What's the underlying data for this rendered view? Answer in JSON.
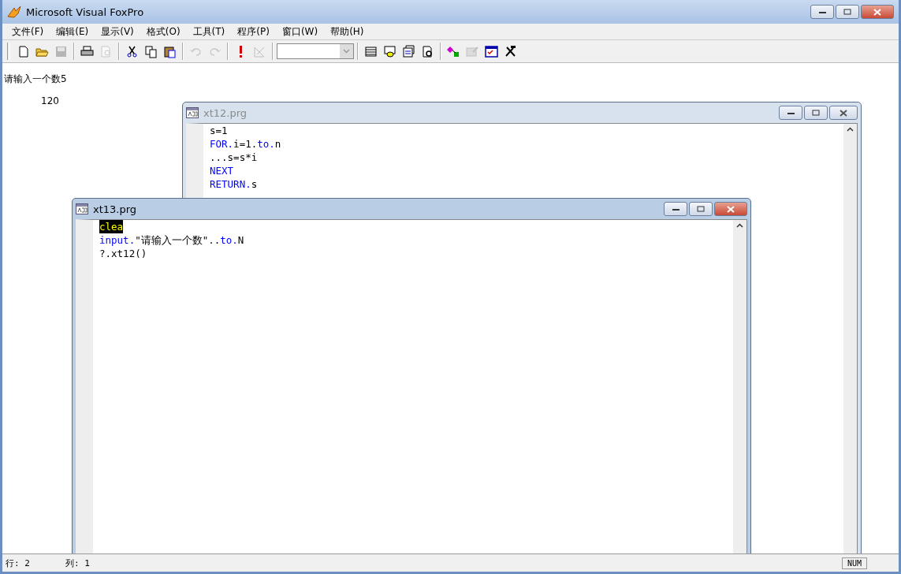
{
  "window": {
    "title": "Microsoft Visual FoxPro"
  },
  "menu": [
    "文件(F)",
    "编辑(E)",
    "显示(V)",
    "格式(O)",
    "工具(T)",
    "程序(P)",
    "窗口(W)",
    "帮助(H)"
  ],
  "toolbar": [
    {
      "kind": "button",
      "disabled": false
    },
    {
      "kind": "button",
      "disabled": false
    },
    {
      "kind": "button",
      "disabled": true
    },
    {
      "kind": "separator"
    },
    {
      "kind": "button",
      "disabled": false
    },
    {
      "kind": "button",
      "disabled": true
    },
    {
      "kind": "separator"
    },
    {
      "kind": "button",
      "disabled": false
    },
    {
      "kind": "button",
      "disabled": false
    },
    {
      "kind": "button",
      "disabled": false
    },
    {
      "kind": "separator"
    },
    {
      "kind": "button",
      "disabled": true
    },
    {
      "kind": "button",
      "disabled": true
    },
    {
      "kind": "separator"
    },
    {
      "kind": "button",
      "disabled": false
    },
    {
      "kind": "button",
      "disabled": true
    },
    {
      "kind": "separator"
    },
    {
      "kind": "combo"
    },
    {
      "kind": "separator"
    },
    {
      "kind": "button",
      "disabled": false
    },
    {
      "kind": "button",
      "disabled": false
    },
    {
      "kind": "button",
      "disabled": false
    },
    {
      "kind": "button",
      "disabled": false
    },
    {
      "kind": "separator"
    },
    {
      "kind": "button",
      "disabled": false
    },
    {
      "kind": "button",
      "disabled": true
    },
    {
      "kind": "button",
      "disabled": false
    },
    {
      "kind": "button",
      "disabled": false
    }
  ],
  "output": [
    {
      "kind": "text",
      "text": "请输入一个数5"
    },
    {
      "kind": "number",
      "text": "120"
    }
  ],
  "editors": [
    {
      "title": "xt12.prg",
      "active": false,
      "lines": [
        [
          {
            "kind": "plain",
            "text": "s=1"
          }
        ],
        [
          {
            "kind": "keyword",
            "text": "FOR."
          },
          {
            "kind": "plain",
            "text": "i=1."
          },
          {
            "kind": "keyword",
            "text": "to."
          },
          {
            "kind": "plain",
            "text": "n"
          }
        ],
        [
          {
            "kind": "plain",
            "text": "...s=s*i"
          }
        ],
        [
          {
            "kind": "keyword",
            "text": "NEXT"
          }
        ],
        [
          {
            "kind": "keyword",
            "text": "RETURN."
          },
          {
            "kind": "plain",
            "text": "s"
          }
        ]
      ]
    },
    {
      "title": "xt13.prg",
      "active": true,
      "lines": [
        [
          {
            "kind": "highlight",
            "text": "clea"
          }
        ],
        [
          {
            "kind": "keyword",
            "text": "input."
          },
          {
            "kind": "plain",
            "text": "\"请输入一个数\".."
          },
          {
            "kind": "keyword",
            "text": "to."
          },
          {
            "kind": "plain",
            "text": "N"
          }
        ],
        [
          {
            "kind": "plain",
            "text": "?.xt12()"
          }
        ]
      ]
    }
  ],
  "status_bar": {
    "row": "行: 2",
    "column": "列: 1",
    "num": "NUM"
  }
}
